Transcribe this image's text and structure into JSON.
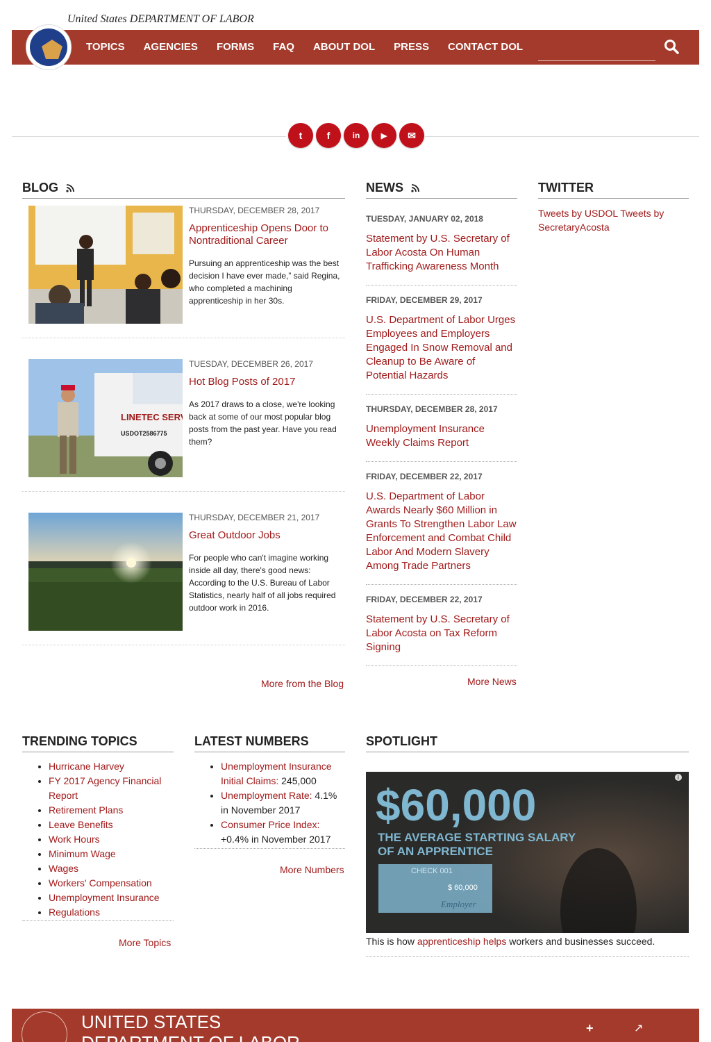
{
  "header": {
    "agency_name": "United States DEPARTMENT OF LABOR",
    "nav": [
      "TOPICS",
      "AGENCIES",
      "FORMS",
      "FAQ",
      "ABOUT DOL",
      "PRESS",
      "CONTACT DOL"
    ],
    "search_placeholder": ""
  },
  "social": [
    {
      "icon": "twitter-icon",
      "glyph": "t"
    },
    {
      "icon": "facebook-icon",
      "glyph": "f"
    },
    {
      "icon": "linkedin-icon",
      "glyph": "in"
    },
    {
      "icon": "youtube-icon",
      "glyph": "▶"
    },
    {
      "icon": "email-icon",
      "glyph": "✉"
    }
  ],
  "blog": {
    "heading": "BLOG",
    "posts": [
      {
        "date": "THURSDAY, DECEMBER 28, 2017",
        "title": "Apprenticeship Opens Door to Nontraditional Career",
        "excerpt": "Pursuing an apprenticeship was the best decision I have ever made,” said Regina, who completed a machining apprenticeship in her 30s."
      },
      {
        "date": "TUESDAY, DECEMBER 26, 2017",
        "title": "Hot Blog Posts of 2017",
        "excerpt": "As 2017 draws to a close, we're looking back at some of our most popular blog posts from the past year. Have you read them?"
      },
      {
        "date": "THURSDAY, DECEMBER 21, 2017",
        "title": "Great Outdoor Jobs",
        "excerpt": "For people who can't imagine working inside all day, there's good news: According to the U.S. Bureau of Labor Statistics, nearly half of all jobs required outdoor work in 2016."
      }
    ],
    "truck_text_1": "LINETEC SERVICES",
    "truck_text_2": "USDOT2586775",
    "more": "More from the Blog"
  },
  "news": {
    "heading": "NEWS",
    "items": [
      {
        "date": "TUESDAY, JANUARY 02, 2018",
        "title": "Statement by U.S. Secretary of Labor Acosta On Human Trafficking Awareness Month"
      },
      {
        "date": "FRIDAY, DECEMBER 29, 2017",
        "title": "U.S. Department of Labor Urges Employees and Employers Engaged In Snow Removal and Cleanup to Be Aware of Potential Hazards"
      },
      {
        "date": "THURSDAY, DECEMBER 28, 2017",
        "title": "Unemployment Insurance Weekly Claims Report"
      },
      {
        "date": "FRIDAY, DECEMBER 22, 2017",
        "title": "U.S. Department of Labor Awards Nearly $60 Million in Grants To Strengthen Labor Law Enforcement and Combat Child Labor And Modern Slavery Among Trade Partners"
      },
      {
        "date": "FRIDAY, DECEMBER 22, 2017",
        "title": "Statement by U.S. Secretary of Labor Acosta on Tax Reform Signing"
      }
    ],
    "more": "More News"
  },
  "twitter": {
    "heading": "TWITTER",
    "link1": "Tweets by USDOL",
    "link2": "Tweets by SecretaryAcosta"
  },
  "trending": {
    "heading": "TRENDING TOPICS",
    "items": [
      "Hurricane Harvey",
      "FY 2017 Agency Financial Report",
      "Retirement Plans",
      "Leave Benefits",
      "Work Hours",
      "Minimum Wage",
      "Wages",
      "Workers' Compensation",
      "Unemployment Insurance",
      "Regulations"
    ],
    "more": "More Topics"
  },
  "numbers": {
    "heading": "LATEST NUMBERS",
    "items": [
      {
        "link": "Unemployment Insurance Initial Claims:",
        "value": " 245,000"
      },
      {
        "link": "Unemployment Rate:",
        "value": " 4.1% in November 2017"
      },
      {
        "link": "Consumer Price Index:",
        "value": " +0.4% in November 2017"
      }
    ],
    "more": "More Numbers"
  },
  "spotlight": {
    "heading": "SPOTLIGHT",
    "big": "$60,000",
    "sub1": "THE AVERAGE STARTING SALARY",
    "sub2": "OF AN APPRENTICE",
    "check_label": "CHECK 001",
    "check_amount": "$ 60,000",
    "check_sig": "Employer",
    "info": "i",
    "caption_pre": "This is how ",
    "caption_link": "apprenticeship helps",
    "caption_post": " workers and businesses succeed."
  },
  "footer": {
    "line1": "UNITED STATES",
    "line2": "DEPARTMENT OF LABOR",
    "add_icon": "+",
    "share_icon": "↗"
  }
}
